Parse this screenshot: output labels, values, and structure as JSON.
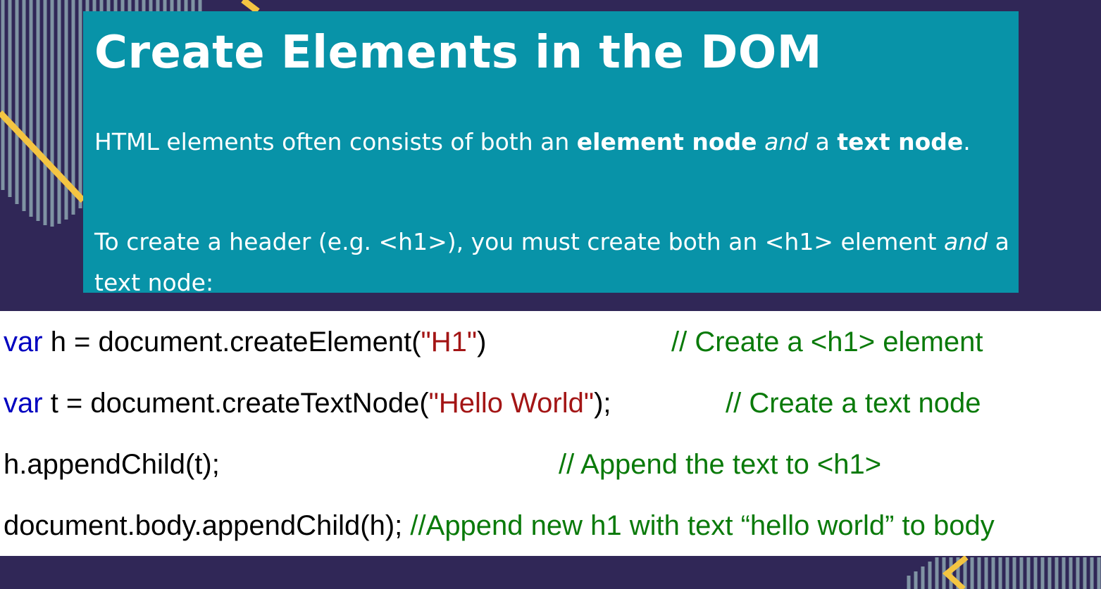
{
  "slide": {
    "title": "Create Elements in the DOM",
    "para1": {
      "t1": "HTML elements often consists of both an ",
      "b1": "element node",
      "t2": " ",
      "i1": "and",
      "t3": " a ",
      "b2": "text node",
      "t4": "."
    },
    "para2": {
      "t1": "To create a header (e.g. <h1>), you must create both an <h1> element ",
      "i1": "and",
      "t2": " a text node:"
    }
  },
  "code": {
    "line1": {
      "kw": "var",
      "code_a": " h = document.createElement(",
      "str": "\"H1\"",
      "code_b": ")",
      "comment": "// Create a <h1> element"
    },
    "line2": {
      "kw": "var",
      "code_a": " t = document.createTextNode(",
      "str": "\"Hello World\"",
      "code_b": ");",
      "comment": "// Create a text node"
    },
    "line3": {
      "code": "h.appendChild(t);",
      "comment": "// Append the text to <h1>"
    },
    "line4": {
      "code": "document.body.appendChild(h); ",
      "comment": "//Append new h1 with text “hello world” to body"
    }
  },
  "colors": {
    "background": "#302757",
    "teal": "#0893a8",
    "accent_yellow": "#f4c542",
    "stripe": "#7f93a3",
    "keyword": "#0000c0",
    "string": "#a31515",
    "comment": "#0a7a0a"
  }
}
